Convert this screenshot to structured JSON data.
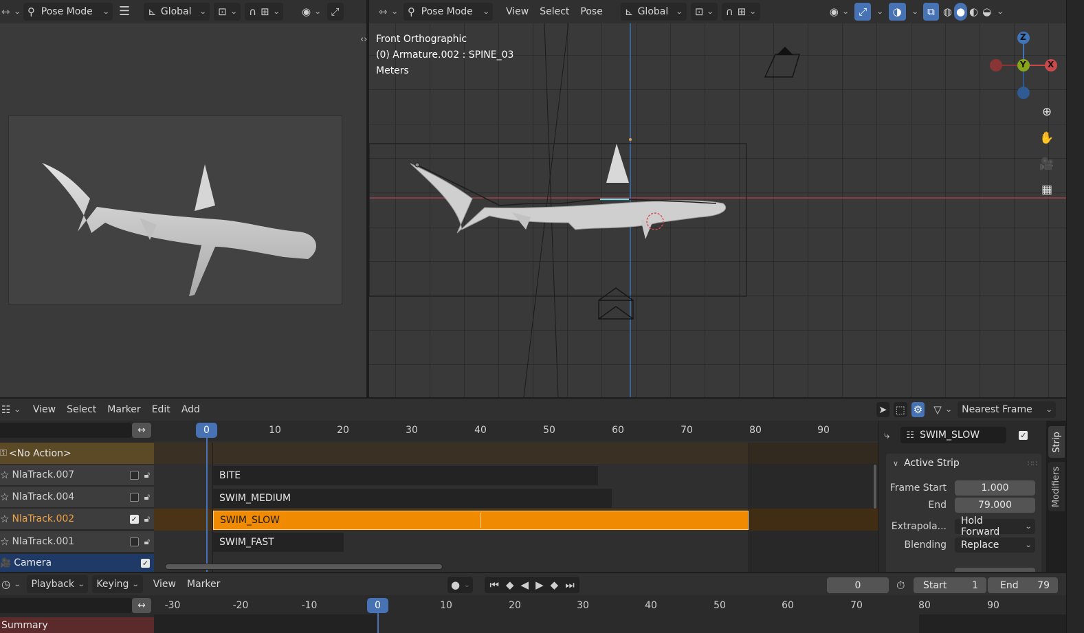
{
  "left_header": {
    "mode_label": "Pose Mode",
    "orientation_label": "Global"
  },
  "viewport_header": {
    "mode_label": "Pose Mode",
    "menus": [
      "View",
      "Select",
      "Pose"
    ],
    "orientation_label": "Global"
  },
  "viewport": {
    "view_name": "Front Orthographic",
    "active_object": "(0) Armature.002 : SPINE_03",
    "units": "Meters",
    "axes": {
      "z": "Z",
      "y": "Y",
      "x": "X"
    }
  },
  "nla_header": {
    "menus": [
      "View",
      "Select",
      "Marker",
      "Edit",
      "Add"
    ],
    "snap_label": "Nearest Frame"
  },
  "nla": {
    "ruler_ticks": [
      "10",
      "20",
      "30",
      "40",
      "50",
      "60",
      "70",
      "80",
      "90"
    ],
    "current_frame": "0",
    "no_action_label": "<No Action>",
    "tracks": [
      {
        "name": "NlaTrack.007",
        "strip": "BITE",
        "active": false,
        "solo": false
      },
      {
        "name": "NlaTrack.004",
        "strip": "SWIM_MEDIUM",
        "active": false,
        "solo": false
      },
      {
        "name": "NlaTrack.002",
        "strip": "SWIM_SLOW",
        "active": true,
        "solo": true
      },
      {
        "name": "NlaTrack.001",
        "strip": "SWIM_FAST",
        "active": false,
        "solo": false
      }
    ],
    "camera_label": "Camera"
  },
  "sidebar": {
    "strip_name": "SWIM_SLOW",
    "panel_title": "Active Strip",
    "frame_start_label": "Frame Start",
    "frame_start_value": "1.000",
    "end_label": "End",
    "end_value": "79.000",
    "extrapolation_label": "Extrapola...",
    "extrapolation_value": "Hold Forward",
    "blending_label": "Blending",
    "blending_value": "Replace",
    "tabs": [
      "Strip",
      "Modifiers"
    ]
  },
  "timeline_header": {
    "menus": [
      "Playback",
      "Keying",
      "View",
      "Marker"
    ],
    "current_frame": "0",
    "start_label": "Start",
    "start_value": "1",
    "end_label": "End",
    "end_value": "79"
  },
  "timeline": {
    "ruler_ticks": [
      "-30",
      "-20",
      "-10",
      "0",
      "10",
      "20",
      "30",
      "40",
      "50",
      "60",
      "70",
      "80",
      "90"
    ],
    "current_frame": "0",
    "summary_label": "Summary"
  },
  "colors": {
    "accent_blue": "#4772b3",
    "active_strip": "#f08a00",
    "active_track_text": "#f0a040",
    "x_axis": "#c94a4a",
    "y_axis": "#86a51a",
    "z_axis": "#3f74b8"
  }
}
